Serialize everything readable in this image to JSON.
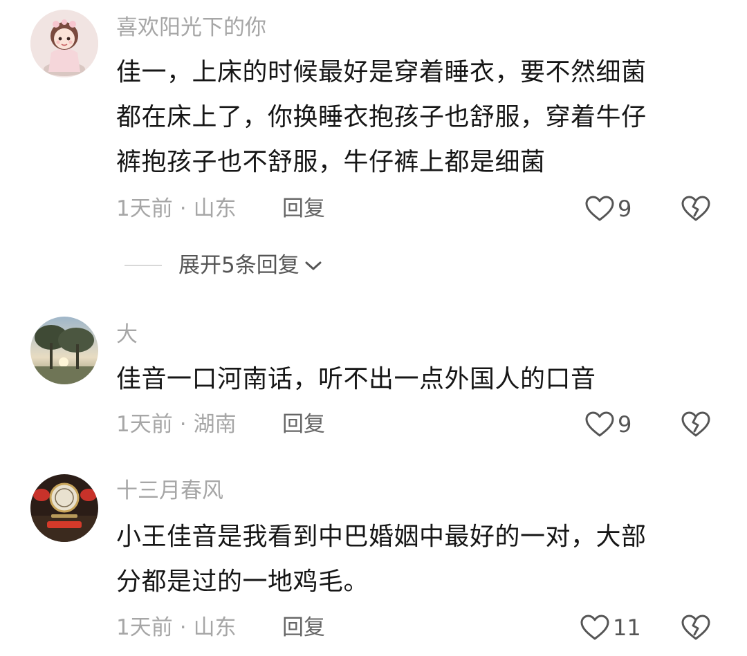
{
  "comments": [
    {
      "username": "喜欢阳光下的你",
      "text_lines": [
        "佳一，上床的时候最好是穿着睡衣，要不然细菌",
        "都在床上了，你换睡衣抱孩子也舒服，穿着牛仔",
        "裤抱孩子也不舒服，牛仔裤上都是细菌"
      ],
      "time": "1天前",
      "separator": "·",
      "location": "山东",
      "reply_label": "回复",
      "likes": "9",
      "avatar_icon": "girl-doll-avatar"
    },
    {
      "username": "大",
      "text_lines": [
        "佳音一口河南话，听不出一点外国人的口音"
      ],
      "time": "1天前",
      "separator": "·",
      "location": "湖南",
      "reply_label": "回复",
      "likes": "9",
      "avatar_icon": "tree-sunset-avatar"
    },
    {
      "username": "十三月春风",
      "text_lines": [
        "小王佳音是我看到中巴婚姻中最好的一对，大部",
        "分都是过的一地鸡毛。"
      ],
      "time": "1天前",
      "separator": "·",
      "location": "山东",
      "reply_label": "回复",
      "likes": "11",
      "avatar_icon": "red-emblem-avatar"
    }
  ],
  "expand_replies": {
    "label": "展开5条回复"
  },
  "colors": {
    "text": "#161616",
    "secondary": "#a6a6a6",
    "icon": "#555555"
  }
}
